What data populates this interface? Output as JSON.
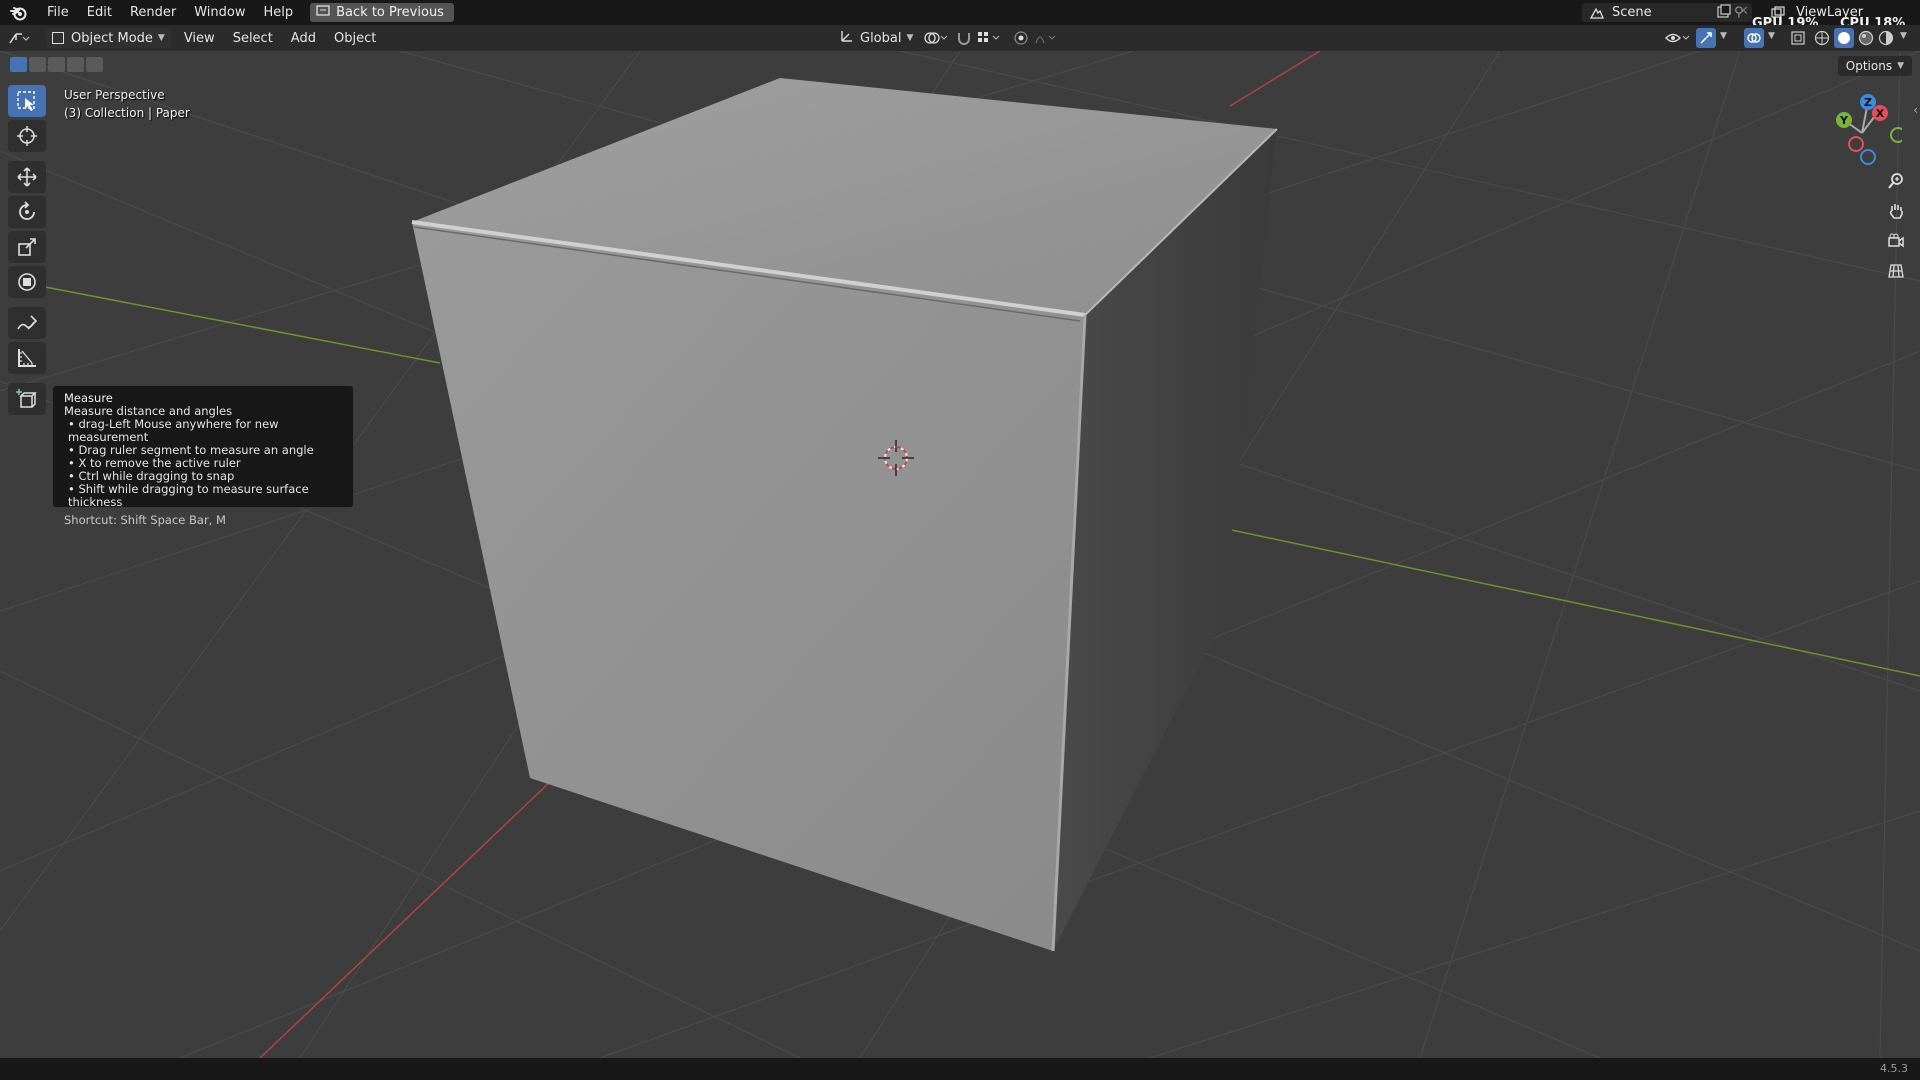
{
  "menubar": {
    "items": [
      "File",
      "Edit",
      "Render",
      "Window",
      "Help"
    ],
    "back_button": "Back to Previous",
    "scene_name": "Scene",
    "view_layer": "ViewLayer",
    "gpu_stat": "GPU 19%",
    "cpu_stat": "CPU 18%"
  },
  "header": {
    "mode": "Object Mode",
    "menus": [
      "View",
      "Select",
      "Add",
      "Object"
    ],
    "transform_orientation": "Global"
  },
  "viewport": {
    "perspective": "User Perspective",
    "collection_info": "(3) Collection | Paper",
    "options_label": "Options",
    "background_color": "#3d3d3d"
  },
  "tooltip": {
    "title": "Measure",
    "description": "Measure distance and angles",
    "bullets": [
      "• drag-Left Mouse anywhere for new measurement",
      "• Drag ruler segment to measure an angle",
      "• X to remove the active ruler",
      "• Ctrl while dragging to snap",
      "• Shift while dragging to measure surface thickness"
    ],
    "shortcut": "Shortcut: Shift Space Bar, M"
  },
  "toolbar": {
    "tools": [
      "select-box",
      "cursor",
      "move",
      "rotate",
      "scale",
      "transform",
      "annotate",
      "measure",
      "add-cube"
    ],
    "active_tool": "select-box",
    "accent_color": "#4772b3"
  },
  "gizmo": {
    "axes": [
      "X",
      "Y",
      "Z"
    ],
    "x_color": "#e44d5e",
    "y_color": "#7bb33c",
    "z_color": "#3c8bdc"
  },
  "statusbar": {
    "version": "4.5.3"
  }
}
